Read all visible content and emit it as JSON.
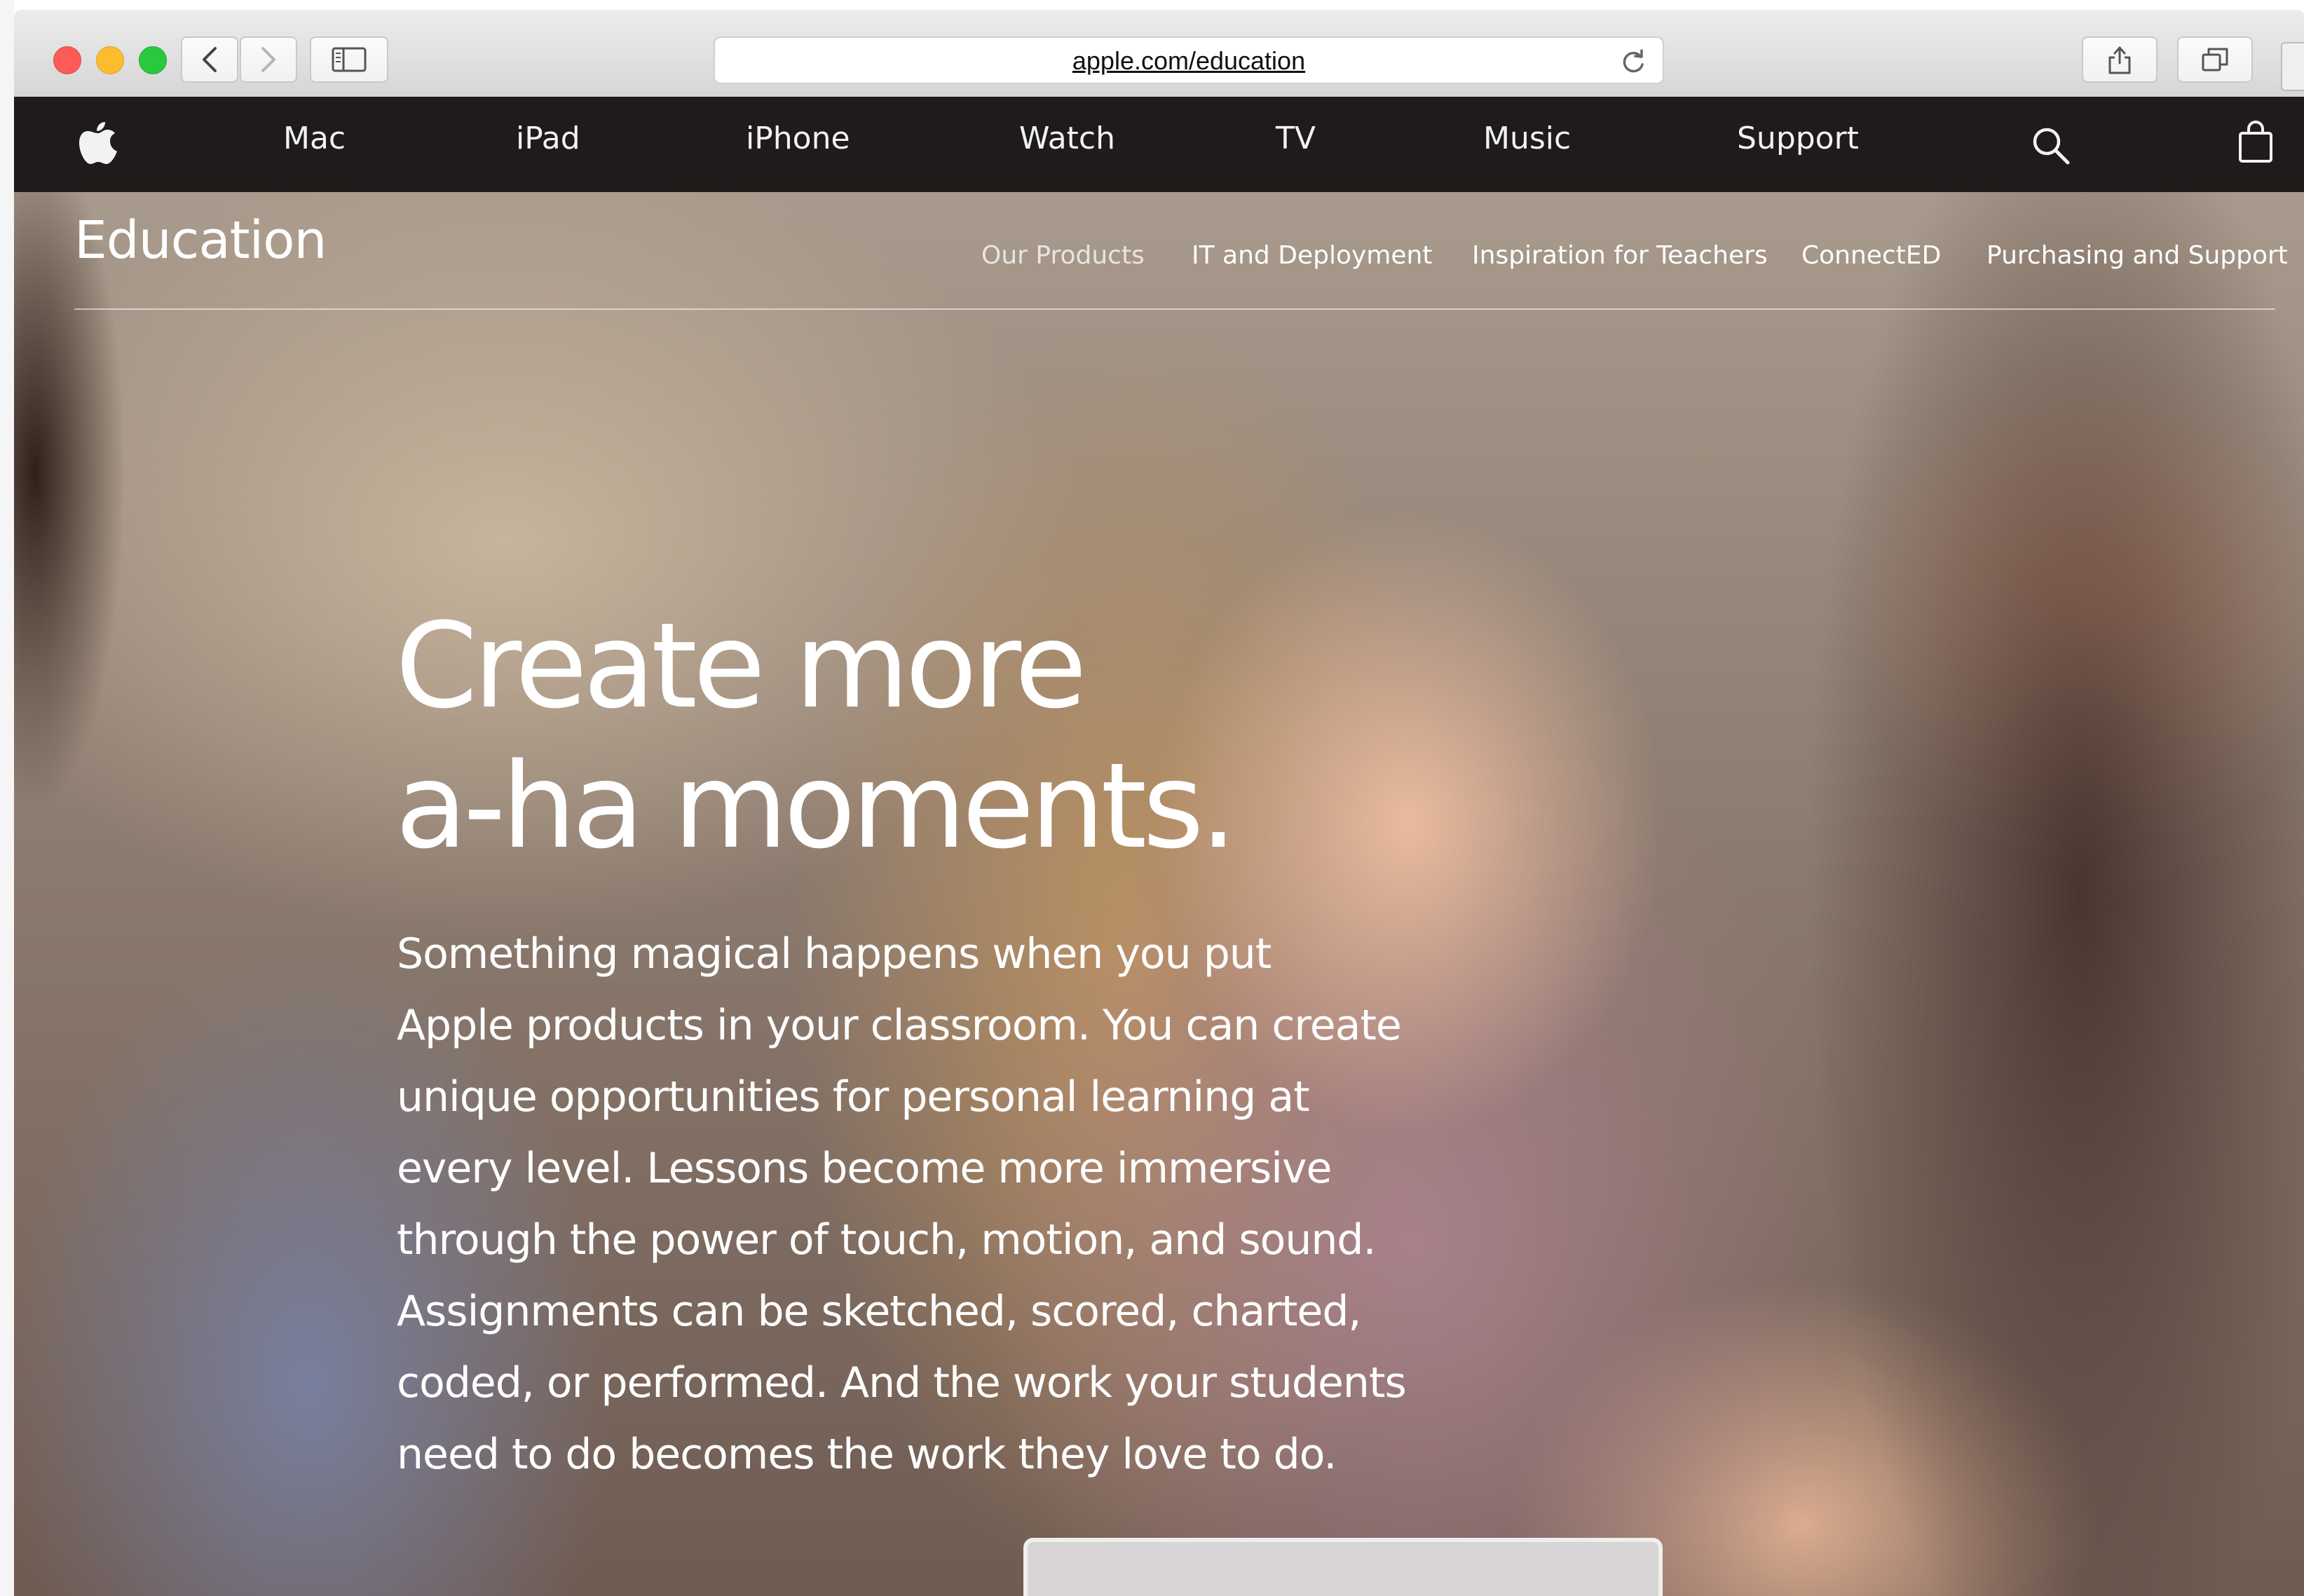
{
  "browser": {
    "url": "apple.com/education"
  },
  "global_nav": {
    "items": [
      {
        "label": "Mac"
      },
      {
        "label": "iPad"
      },
      {
        "label": "iPhone"
      },
      {
        "label": "Watch"
      },
      {
        "label": "TV"
      },
      {
        "label": "Music"
      },
      {
        "label": "Support"
      }
    ],
    "icons": {
      "logo": "apple-logo-icon",
      "search": "search-icon",
      "bag": "shopping-bag-icon"
    }
  },
  "local_nav": {
    "title": "Education",
    "links": [
      {
        "label": "Our Products"
      },
      {
        "label": "IT and Deployment"
      },
      {
        "label": "Inspiration for Teachers"
      },
      {
        "label": "ConnectED"
      },
      {
        "label": "Purchasing and Support"
      }
    ]
  },
  "hero": {
    "headline_lines": [
      "Create more",
      "a-ha moments."
    ],
    "body_lines": [
      "Something magical happens when you put",
      "Apple products in your classroom. You can create",
      "unique opportunities for personal learning at",
      "every level. Lessons become more immersive",
      "through the power of touch, motion, and sound.",
      "Assignments can be sketched, scored, charted,",
      "coded, or performed. And the work your students",
      "need to do becomes the work they love to do."
    ]
  },
  "colors": {
    "global_nav_bg": "#1e1b1a",
    "text_on_photo": "#ffffff",
    "close": "#fc5b57",
    "minimize": "#fdbb2e",
    "zoom": "#2ac83f"
  }
}
